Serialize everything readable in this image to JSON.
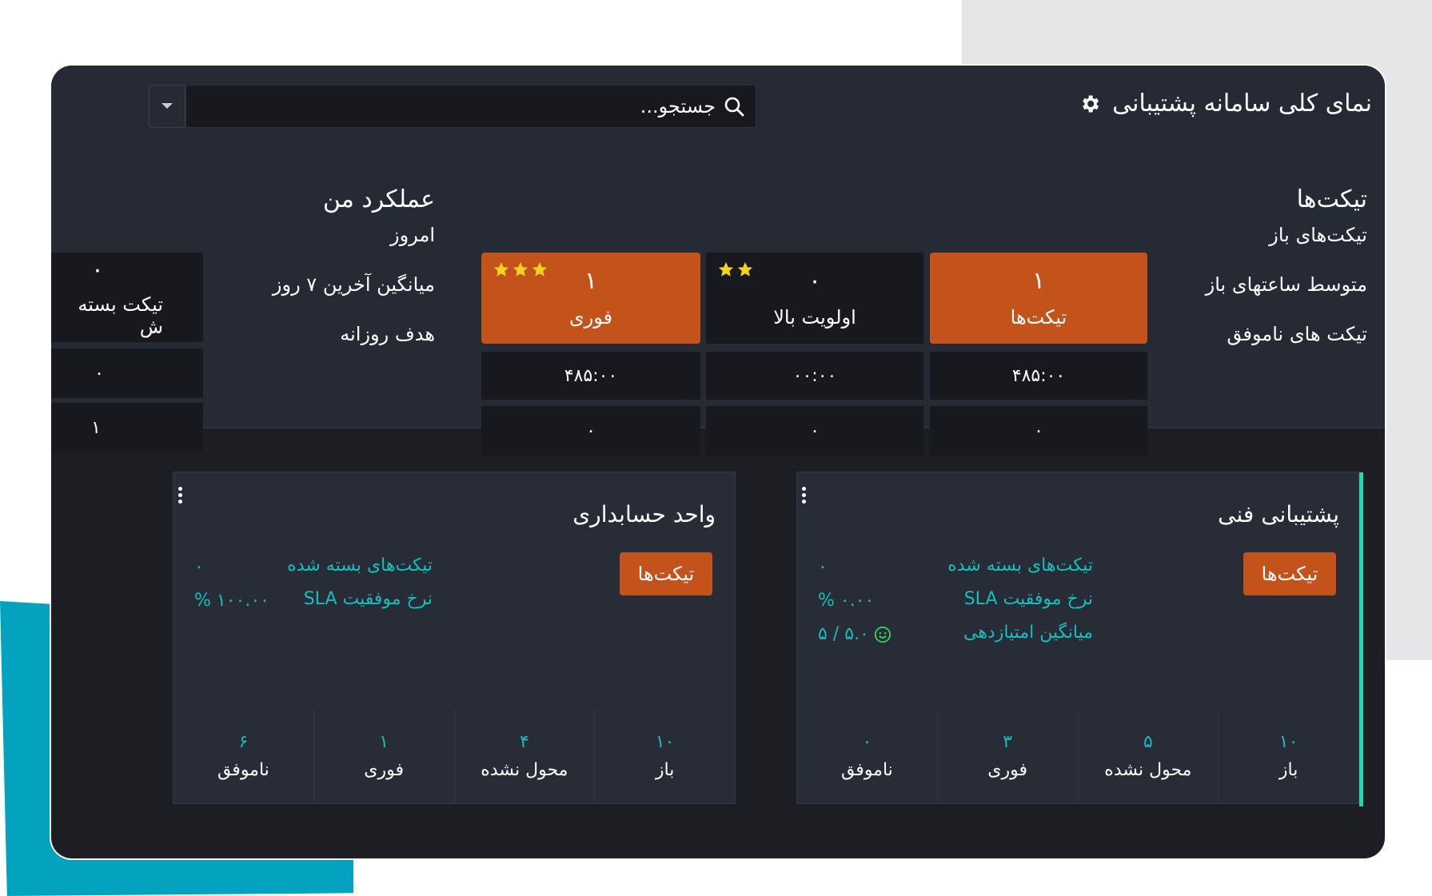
{
  "header": {
    "title": "نمای کلی سامانه پشتیبانی",
    "search_placeholder": "جستجو..."
  },
  "tickets_section": {
    "heading": "تیکت‌ها",
    "row_labels": [
      "تیکت‌های باز",
      "متوسط ساعتهای باز",
      "تیکت های ناموفق"
    ],
    "columns": [
      {
        "label": "تیکت‌ها",
        "count": "۱",
        "stars": 0,
        "style": "orange",
        "avg_hours": "۴۸۵:۰۰",
        "failed": "۰"
      },
      {
        "label": "اولویت بالا",
        "count": "۰",
        "stars": 2,
        "style": "dark",
        "avg_hours": "۰۰:۰۰",
        "failed": "۰"
      },
      {
        "label": "فوری",
        "count": "۱",
        "stars": 3,
        "style": "orange",
        "avg_hours": "۴۸۵:۰۰",
        "failed": "۰"
      }
    ]
  },
  "performance_section": {
    "heading": "عملکرد من",
    "row_labels": [
      "امروز",
      "میانگین آخرین ۷ روز",
      "هدف روزانه"
    ],
    "closed_count": "۰",
    "closed_label": "تیکت بسته ش",
    "avg_value": "۰",
    "goal_value": "۱"
  },
  "teams": [
    {
      "name": "پشتیبانی فنی",
      "button": "تیکت‌ها",
      "metrics": [
        {
          "label": "تیکت‌های بسته شده",
          "value": "۰"
        },
        {
          "label": "نرخ موفقیت SLA",
          "value": "% ۰.۰۰"
        },
        {
          "label": "میانگین امتیازدهی",
          "value": "۵ / ۵.۰"
        }
      ],
      "stats": [
        {
          "label": "باز",
          "value": "۱۰"
        },
        {
          "label": "محول نشده",
          "value": "۵"
        },
        {
          "label": "فوری",
          "value": "۳"
        },
        {
          "label": "ناموفق",
          "value": "۰"
        }
      ]
    },
    {
      "name": "واحد حسابداری",
      "button": "تیکت‌ها",
      "metrics": [
        {
          "label": "تیکت‌های بسته شده",
          "value": "۰"
        },
        {
          "label": "نرخ موفقیت SLA",
          "value": "% ۱۰۰.۰۰"
        }
      ],
      "stats": [
        {
          "label": "باز",
          "value": "۱۰"
        },
        {
          "label": "محول نشده",
          "value": "۴"
        },
        {
          "label": "فوری",
          "value": "۱"
        },
        {
          "label": "ناموفق",
          "value": "۶"
        }
      ]
    }
  ],
  "colors": {
    "accent_orange": "#c4521b",
    "accent_teal": "#15bfbf",
    "panel": "#262a34",
    "cell": "#17191e"
  }
}
